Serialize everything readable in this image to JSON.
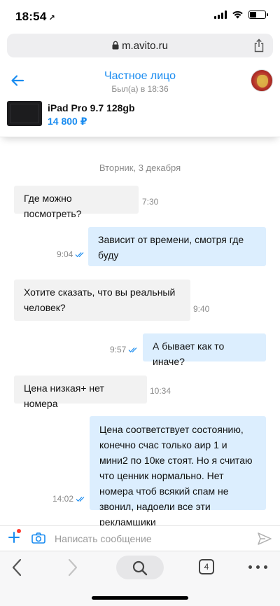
{
  "status_bar": {
    "time": "18:54",
    "location_arrow": "↗"
  },
  "browser": {
    "url": "m.avito.ru",
    "tab_count": "4"
  },
  "header": {
    "contact_name": "Частное лицо",
    "last_seen": "Был(а) в 18:36",
    "item_title": "iPad Pro 9.7 128gb",
    "item_price": "14 800 ₽"
  },
  "chat": {
    "date_separator": "Вторник, 3 декабря",
    "messages": [
      {
        "direction": "in",
        "text": "Где можно посмотреть?",
        "time": "7:30"
      },
      {
        "direction": "out",
        "text": "Зависит от времени, смотря где буду",
        "time": "9:04"
      },
      {
        "direction": "in",
        "text": "Хотите сказать, что вы реальный человек?",
        "time": "9:40"
      },
      {
        "direction": "out",
        "text": "А бывает как то иначе?",
        "time": "9:57"
      },
      {
        "direction": "in",
        "text": "Цена низкая+ нет номера",
        "time": "10:34"
      },
      {
        "direction": "out",
        "text": "Цена соответствует состоянию, конечно счас только аир 1 и мини2 по 10ке стоят. Но я считаю что ценник нормально. Нет номера чтоб всякий спам не звонил, надоели все эти рекламщики",
        "time": "14:02"
      }
    ]
  },
  "composer": {
    "placeholder": "Написать сообщение"
  },
  "colors": {
    "accent": "#1a8cf0",
    "incoming_bubble": "#f2f2f2",
    "outgoing_bubble": "#dceefe",
    "badge": "#ff3b30"
  }
}
